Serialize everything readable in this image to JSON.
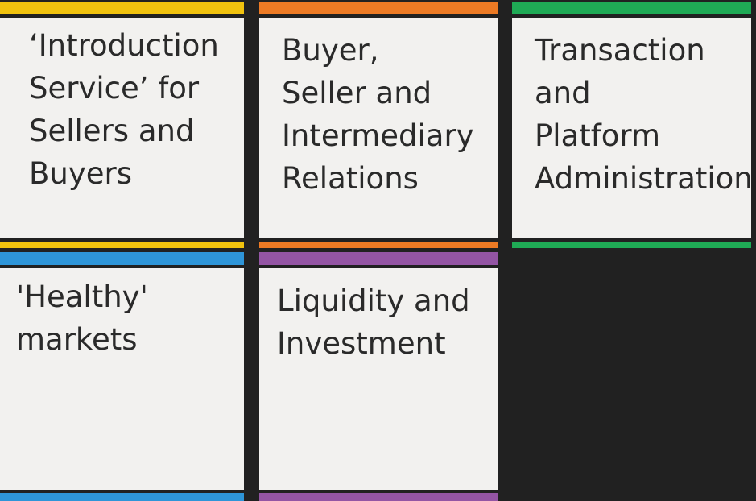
{
  "tiles": [
    {
      "id": "introduction-service",
      "color": "#f0c20e",
      "lines": [
        "‘Introduction",
        "Service’ for",
        "Sellers and",
        "Buyers"
      ]
    },
    {
      "id": "buyer-seller-relations",
      "color": "#ec7a24",
      "lines": [
        "Buyer,",
        "Seller and",
        "Intermediary",
        "Relations"
      ]
    },
    {
      "id": "transaction-platform-admin",
      "color": "#1faa55",
      "lines": [
        "Transaction",
        "and",
        "Platform",
        "Administration"
      ]
    },
    {
      "id": "healthy-markets",
      "color": "#2e95d8",
      "lines": [
        "'Healthy'",
        "markets"
      ]
    },
    {
      "id": "liquidity-investment",
      "color": "#9455a4",
      "lines": [
        "Liquidity and",
        "Investment"
      ]
    }
  ]
}
